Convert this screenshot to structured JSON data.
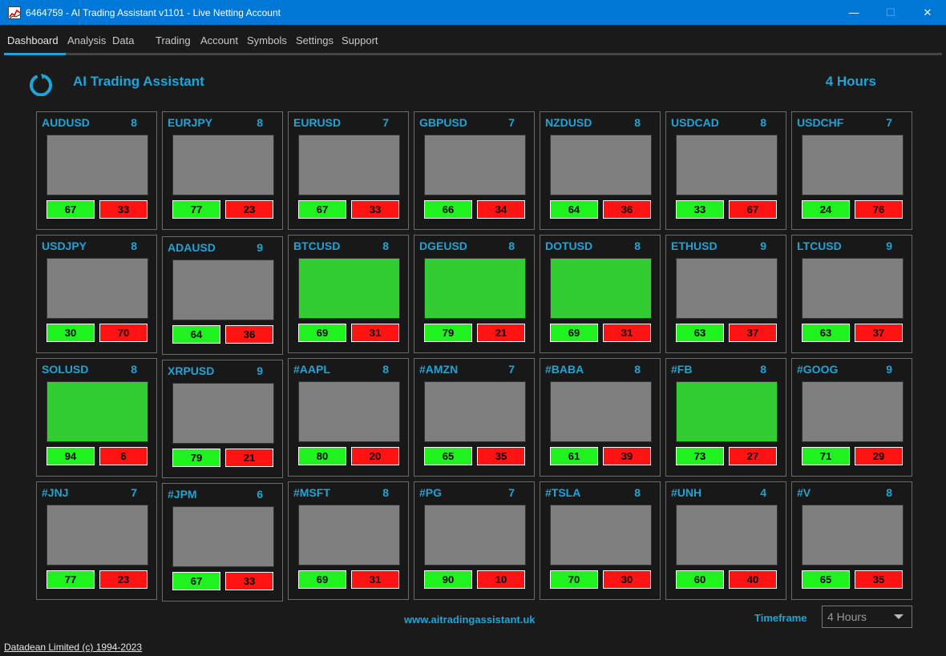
{
  "window": {
    "title": "6464759 - AI Trading Assistant v1101 - Live Netting Account",
    "minimize": "—",
    "maximize": "☐",
    "close": "✕"
  },
  "menu": {
    "items": [
      "Dashboard",
      "Analysis",
      "Data",
      "Trading",
      "Account",
      "Symbols",
      "Settings",
      "Support"
    ],
    "active": "Dashboard"
  },
  "header": {
    "title": "AI Trading Assistant",
    "timeframe": "4 Hours"
  },
  "colors": {
    "accent": "#1ca5d8",
    "buy": "#1ff21f",
    "sell": "#ff1212",
    "signal_green": "#33cc33",
    "neutral_gray": "#7f7f7f"
  },
  "cards": [
    {
      "symbol": "AUDUSD",
      "score": "8",
      "buy": "67",
      "sell": "33",
      "state": "neutral"
    },
    {
      "symbol": "EURJPY",
      "score": "8",
      "buy": "77",
      "sell": "23",
      "state": "neutral"
    },
    {
      "symbol": "EURUSD",
      "score": "7",
      "buy": "67",
      "sell": "33",
      "state": "neutral"
    },
    {
      "symbol": "GBPUSD",
      "score": "7",
      "buy": "66",
      "sell": "34",
      "state": "neutral"
    },
    {
      "symbol": "NZDUSD",
      "score": "8",
      "buy": "64",
      "sell": "36",
      "state": "neutral"
    },
    {
      "symbol": "USDCAD",
      "score": "8",
      "buy": "33",
      "sell": "67",
      "state": "neutral"
    },
    {
      "symbol": "USDCHF",
      "score": "7",
      "buy": "24",
      "sell": "76",
      "state": "neutral"
    },
    {
      "symbol": "USDJPY",
      "score": "8",
      "buy": "30",
      "sell": "70",
      "state": "neutral"
    },
    {
      "symbol": "ADAUSD",
      "score": "9",
      "buy": "64",
      "sell": "36",
      "state": "neutral"
    },
    {
      "symbol": "BTCUSD",
      "score": "8",
      "buy": "69",
      "sell": "31",
      "state": "buy"
    },
    {
      "symbol": "DGEUSD",
      "score": "8",
      "buy": "79",
      "sell": "21",
      "state": "buy"
    },
    {
      "symbol": "DOTUSD",
      "score": "8",
      "buy": "69",
      "sell": "31",
      "state": "buy"
    },
    {
      "symbol": "ETHUSD",
      "score": "9",
      "buy": "63",
      "sell": "37",
      "state": "neutral"
    },
    {
      "symbol": "LTCUSD",
      "score": "9",
      "buy": "63",
      "sell": "37",
      "state": "neutral"
    },
    {
      "symbol": "SOLUSD",
      "score": "8",
      "buy": "94",
      "sell": "6",
      "state": "buy"
    },
    {
      "symbol": "XRPUSD",
      "score": "9",
      "buy": "79",
      "sell": "21",
      "state": "neutral"
    },
    {
      "symbol": "#AAPL",
      "score": "8",
      "buy": "80",
      "sell": "20",
      "state": "neutral"
    },
    {
      "symbol": "#AMZN",
      "score": "7",
      "buy": "65",
      "sell": "35",
      "state": "neutral"
    },
    {
      "symbol": "#BABA",
      "score": "8",
      "buy": "61",
      "sell": "39",
      "state": "neutral"
    },
    {
      "symbol": "#FB",
      "score": "8",
      "buy": "73",
      "sell": "27",
      "state": "buy"
    },
    {
      "symbol": "#GOOG",
      "score": "9",
      "buy": "71",
      "sell": "29",
      "state": "neutral"
    },
    {
      "symbol": "#JNJ",
      "score": "7",
      "buy": "77",
      "sell": "23",
      "state": "neutral"
    },
    {
      "symbol": "#JPM",
      "score": "6",
      "buy": "67",
      "sell": "33",
      "state": "neutral"
    },
    {
      "symbol": "#MSFT",
      "score": "8",
      "buy": "69",
      "sell": "31",
      "state": "neutral"
    },
    {
      "symbol": "#PG",
      "score": "7",
      "buy": "90",
      "sell": "10",
      "state": "neutral"
    },
    {
      "symbol": "#TSLA",
      "score": "8",
      "buy": "70",
      "sell": "30",
      "state": "neutral"
    },
    {
      "symbol": "#UNH",
      "score": "4",
      "buy": "60",
      "sell": "40",
      "state": "neutral"
    },
    {
      "symbol": "#V",
      "score": "8",
      "buy": "65",
      "sell": "35",
      "state": "neutral"
    }
  ],
  "footer": {
    "website": "www.aitradingassistant.uk",
    "timeframe_label": "Timeframe",
    "timeframe_value": "4 Hours",
    "copyright": "Datadean Limited (c) 1994-2023"
  }
}
